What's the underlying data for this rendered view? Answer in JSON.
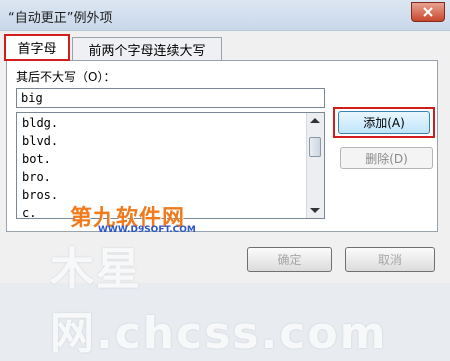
{
  "window": {
    "title": "“自动更正”例外项"
  },
  "tabs": [
    {
      "label": "首字母",
      "active": true
    },
    {
      "label": "前两个字母连续大写",
      "active": false
    }
  ],
  "form": {
    "label": "其后不大写（O）：",
    "input_value": "big",
    "list_items": [
      "bldg.",
      "blvd.",
      "bot.",
      "bro.",
      "bros.",
      "c."
    ]
  },
  "buttons": {
    "add": "添加(A)",
    "delete": "删除(D)",
    "ok": "确定",
    "cancel": "取消"
  },
  "watermarks": {
    "line1": "第九软件网",
    "line1_url": "WWW.D9SOFT.COM",
    "line2": "木星网.chcss.com"
  },
  "colors": {
    "highlight_red": "#d21d1d",
    "watermark_orange": "#f07a1c"
  }
}
